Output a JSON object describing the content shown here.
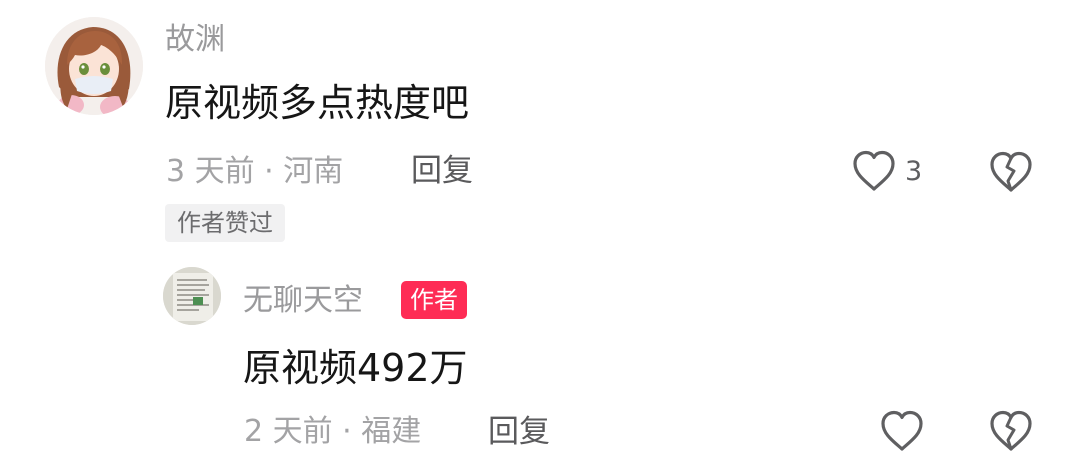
{
  "comment": {
    "username": "故渊",
    "text": "原视频多点热度吧",
    "meta": "3 天前 · 河南",
    "reply_label": "回复",
    "like_count": "3",
    "liked_badge": "作者赞过",
    "avatar": "anime-girl-avatar"
  },
  "reply": {
    "username": "无聊天空",
    "author_badge": "作者",
    "text": "原视频492万",
    "meta": "2 天前 · 福建",
    "reply_label": "回复",
    "avatar": "document-photo-avatar"
  },
  "icons": {
    "like": "heart-outline-icon",
    "dislike": "broken-heart-icon"
  },
  "colors": {
    "accent": "#fe2c55",
    "meta_gray": "#a3a3a5",
    "text": "#161616"
  }
}
